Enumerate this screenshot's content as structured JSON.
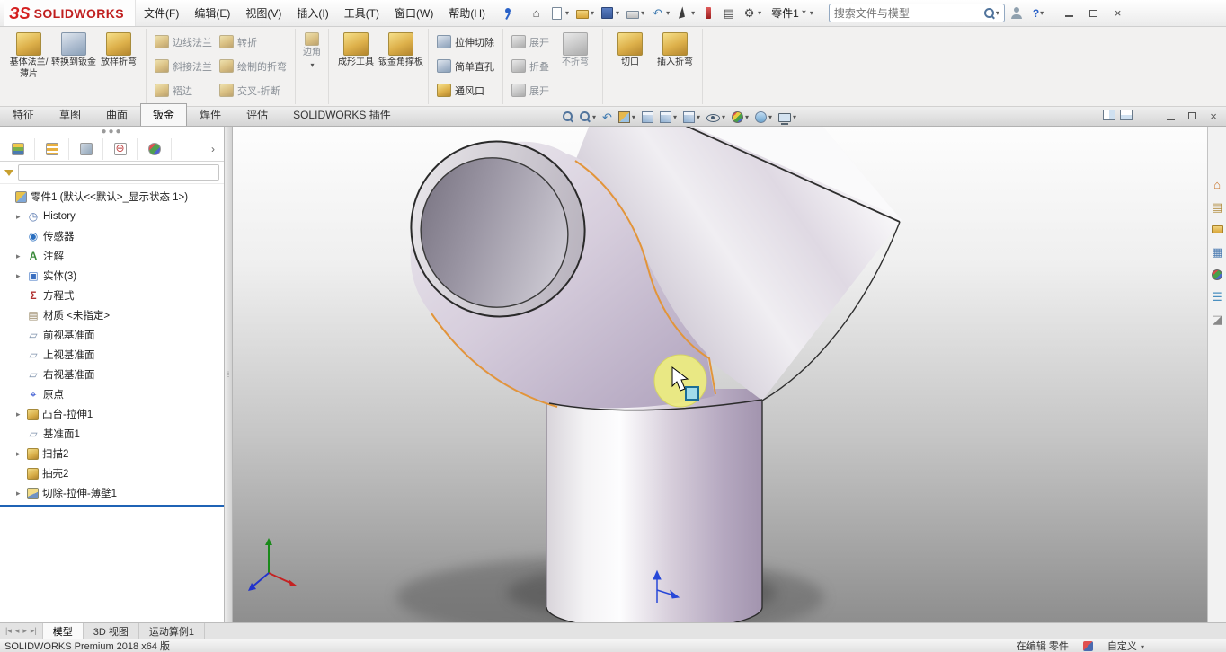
{
  "titlebar": {
    "logo_ds": "ЗS",
    "logo_brand": "SOLIDWORKS",
    "menus": [
      "文件(F)",
      "编辑(E)",
      "视图(V)",
      "插入(I)",
      "工具(T)",
      "窗口(W)",
      "帮助(H)"
    ],
    "doc_name": "零件1 *",
    "search_placeholder": "搜索文件与模型",
    "help_label": "?",
    "icons": [
      "pin-menu",
      "home",
      "new-document",
      "open",
      "save",
      "print",
      "undo",
      "select-cursor",
      "xpress-tools",
      "properties",
      "settings",
      "user-account",
      "help",
      "minimize",
      "restore",
      "close"
    ]
  },
  "ribbon": {
    "base_flange": "基体法兰/薄片",
    "convert_to_sheet_metal": "转换到钣金",
    "lofted_bend": "放样折弯",
    "edge_flange": "边线法兰",
    "miter_flange": "斜接法兰",
    "hem": "褶边",
    "jog": "转折",
    "sketched_bend": "绘制的折弯",
    "cross_break": "交叉-折断",
    "corner": "边角",
    "forming_tool": "成形工具",
    "sheet_metal_gusset": "钣金角撑板",
    "extruded_cut": "拉伸切除",
    "simple_hole": "简单直孔",
    "vent": "通风口",
    "unfold": "展开",
    "fold": "折叠",
    "flatten": "展开",
    "no_bends": "不折弯",
    "rip": "切口",
    "insert_bends": "插入折弯"
  },
  "command_tabs": {
    "items": [
      "特征",
      "草图",
      "曲面",
      "钣金",
      "焊件",
      "评估",
      "SOLIDWORKS 插件"
    ],
    "active": "钣金"
  },
  "feature_tree": {
    "root": "零件1 (默认<<默认>_显示状态 1>)",
    "items": [
      {
        "label": "History",
        "icon": "history-folder"
      },
      {
        "label": "传感器",
        "icon": "sensors"
      },
      {
        "label": "注解",
        "icon": "annotations"
      },
      {
        "label": "实体(3)",
        "icon": "solid-bodies-folder"
      },
      {
        "label": "方程式",
        "icon": "equations"
      },
      {
        "label": "材质 <未指定>",
        "icon": "material"
      },
      {
        "label": "前视基准面",
        "icon": "plane"
      },
      {
        "label": "上视基准面",
        "icon": "plane"
      },
      {
        "label": "右视基准面",
        "icon": "plane"
      },
      {
        "label": "原点",
        "icon": "origin"
      },
      {
        "label": "凸台-拉伸1",
        "icon": "boss-extrude"
      },
      {
        "label": "基准面1",
        "icon": "plane"
      },
      {
        "label": "扫描2",
        "icon": "sweep"
      },
      {
        "label": "抽壳2",
        "icon": "shell"
      },
      {
        "label": "切除-拉伸-薄壁1",
        "icon": "cut-extrude-thin"
      }
    ]
  },
  "viewport": {
    "hud_icons": [
      "zoom-to-fit",
      "zoom-to-area",
      "previous-view",
      "section-view",
      "dynamic-annotation-views",
      "view-orientation",
      "display-style",
      "hide-show-items",
      "edit-appearance",
      "apply-scene",
      "view-settings"
    ],
    "window_icons": [
      "split-vertical",
      "split-horizontal",
      "minimize",
      "restore",
      "close"
    ],
    "taskpane_icons": [
      "solidworks-resources",
      "design-library",
      "file-explorer",
      "view-palette",
      "appearances-scenes",
      "custom-properties",
      "solidworks-forum"
    ],
    "highlight_color": "#efef7e",
    "selection_color": "#e8993a",
    "model_color": "#cfc5d6"
  },
  "bottom_tabs": {
    "items": [
      "模型",
      "3D 视图",
      "运动算例1"
    ],
    "active": "模型"
  },
  "statusbar": {
    "product": "SOLIDWORKS Premium 2018 x64 版",
    "editing_status": "在编辑 零件",
    "customize": "自定义"
  }
}
